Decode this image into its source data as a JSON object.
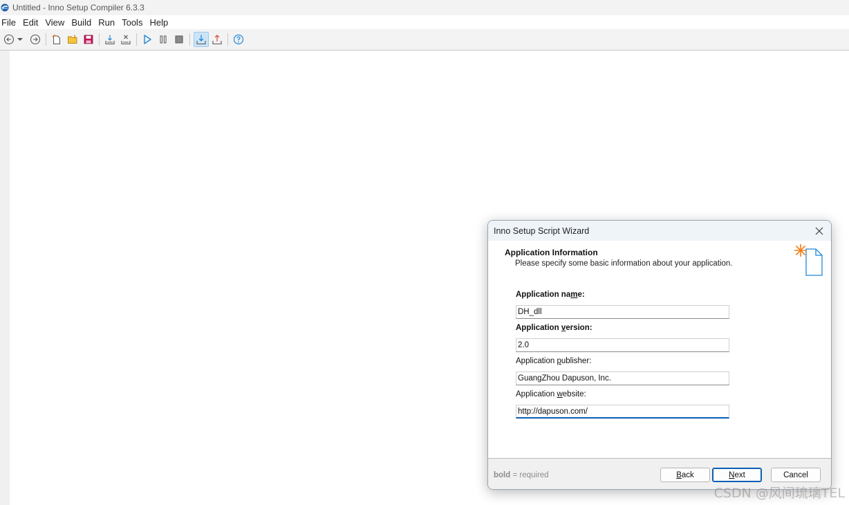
{
  "window": {
    "title": "Untitled - Inno Setup Compiler 6.3.3",
    "icon": "inno-setup-app-icon"
  },
  "menubar": {
    "items": [
      "File",
      "Edit",
      "View",
      "Build",
      "Run",
      "Tools",
      "Help"
    ]
  },
  "toolbar": {
    "buttons": [
      {
        "icon": "back-arrow-icon"
      },
      {
        "icon": "dropdown-arrow-icon"
      },
      {
        "icon": "forward-arrow-icon"
      },
      {
        "icon": "new-file-icon"
      },
      {
        "icon": "open-folder-icon"
      },
      {
        "icon": "save-icon"
      },
      {
        "icon": "compile-icon"
      },
      {
        "icon": "stop-compile-icon"
      },
      {
        "icon": "run-icon",
        "color": "#1e88d8"
      },
      {
        "icon": "pause-icon"
      },
      {
        "icon": "stop-icon"
      },
      {
        "icon": "target-setup-icon",
        "active": true
      },
      {
        "icon": "target-uninstall-icon"
      },
      {
        "icon": "help-icon",
        "color": "#1e88d8"
      }
    ]
  },
  "dialog": {
    "title": "Inno Setup Script Wizard",
    "section_title": "Application Information",
    "section_subtitle": "Please specify some basic information about your application.",
    "fields": {
      "app_name": {
        "label_pre": "Application na",
        "label_key": "m",
        "label_post": "e:",
        "value": "DH_dll",
        "required": true
      },
      "app_version": {
        "label_pre": "Application ",
        "label_key": "v",
        "label_post": "ersion:",
        "value": "2.0",
        "required": true
      },
      "app_publisher": {
        "label_pre": "Application ",
        "label_key": "p",
        "label_post": "ublisher:",
        "value": "GuangZhou Dapuson, Inc.",
        "required": false
      },
      "app_website": {
        "label_pre": "Application ",
        "label_key": "w",
        "label_post": "ebsite:",
        "value": "http://dapuson.com/",
        "required": false
      }
    },
    "footer": {
      "hint_bold": "bold",
      "hint_rest": " = required",
      "back_key": "B",
      "back_rest": "ack",
      "next_key": "N",
      "next_rest": "ext",
      "cancel_label": "Cancel"
    }
  },
  "watermark": "CSDN @风间琉璃TEL",
  "colors": {
    "accent": "#0a5fb4",
    "toolbar_bg": "#f3f3f3",
    "dialog_title_bg": "#eff4f9",
    "icon_orange": "#f07d17",
    "icon_blue": "#1e88d8"
  }
}
